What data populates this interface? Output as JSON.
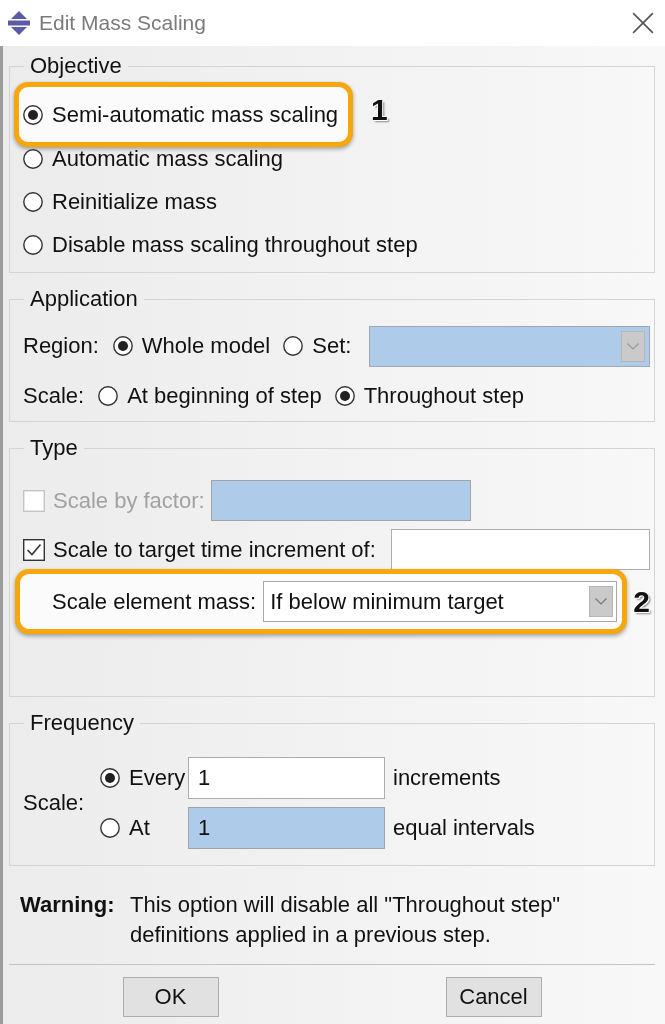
{
  "window": {
    "title": "Edit Mass Scaling"
  },
  "objective": {
    "title": "Objective",
    "options": [
      {
        "label": "Semi-automatic mass scaling",
        "selected": true,
        "callout": "1"
      },
      {
        "label": "Automatic mass scaling",
        "selected": false
      },
      {
        "label": "Reinitialize mass",
        "selected": false
      },
      {
        "label": "Disable mass scaling throughout step",
        "selected": false
      }
    ]
  },
  "application": {
    "title": "Application",
    "region": {
      "label": "Region:",
      "options": [
        {
          "label": "Whole model",
          "selected": true
        },
        {
          "label": "Set:",
          "selected": false,
          "dropdown": true
        }
      ]
    },
    "scale": {
      "label": "Scale:",
      "options": [
        {
          "label": "At beginning of step",
          "selected": false
        },
        {
          "label": "Throughout step",
          "selected": true
        }
      ]
    }
  },
  "type": {
    "title": "Type",
    "options": [
      {
        "label": "Scale by factor:",
        "checked": false,
        "disabled": true
      },
      {
        "label": "Scale to target time increment of:",
        "checked": true,
        "disabled": false
      }
    ],
    "element_mass": {
      "label": "Scale element mass:",
      "value": "If below minimum target",
      "callout": "2"
    }
  },
  "frequency": {
    "title": "Frequency",
    "label": "Scale:",
    "options": [
      {
        "label": "Every",
        "selected": true,
        "value": "1",
        "unit": "increments"
      },
      {
        "label": "At",
        "selected": false,
        "value": "1",
        "unit": "equal intervals"
      }
    ]
  },
  "warning": {
    "label": "Warning:",
    "text": "This option will disable all \"Throughout step\" definitions applied in a previous step."
  },
  "buttons": [
    {
      "label": "OK"
    },
    {
      "label": "Cancel"
    }
  ]
}
